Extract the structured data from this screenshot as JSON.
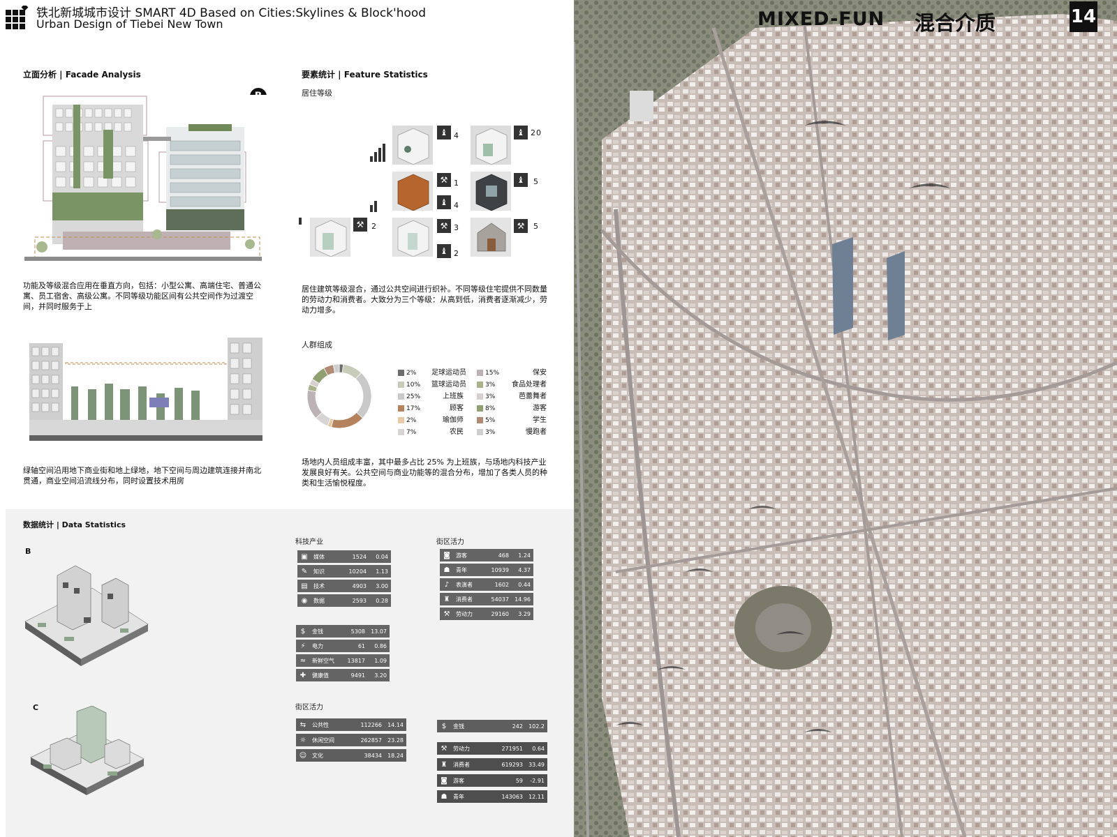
{
  "header": {
    "title_cn": "铁北新城城市设计  SMART 4D Based on Cities:Skylines & Block'hood",
    "title_en": "Urban Design of Tiebei New Town"
  },
  "right_panel": {
    "heading_en": "MIXED-FUN",
    "heading_cn": "混合介质",
    "page_number": "14"
  },
  "facade": {
    "heading": "立面分析 | Facade Analysis",
    "badge": "B",
    "text1": "功能及等级混合应用在垂直方向，包括：小型公寓、高端住宅、普通公寓、员工宿舍、高级公寓。不同等级功能区间有公共空间作为过渡空间，并同时服务于上",
    "text2": "绿轴空间沿用地下商业街和地上绿地，地下空间与周边建筑连接并南北贯通，商业空间沿流线分布，同时设置技术用房"
  },
  "features": {
    "heading": "要素统计 | Feature Statistics",
    "residence_title": "居住等级",
    "residence_nums": [
      "4",
      "20",
      "1",
      "4",
      "5",
      "2",
      "3",
      "2",
      "5"
    ],
    "residence_text": "居住建筑等级混合，通过公共空间进行织补。不同等级住宅提供不同数量的劳动力和消费者。大致分为三个等级：从高到低，消费者逐渐减少，劳动力增多。",
    "crowd_title": "人群组成",
    "crowd_text": "场地内人员组成丰富，其中最多占比 25% 为上班族，与场地内科技产业发展良好有关。公共空间与商业功能等的混合分布，增加了各类人员的种类和生活愉悦程度。"
  },
  "chart_data": {
    "type": "pie",
    "title": "人群组成",
    "series": [
      {
        "name": "足球运动员",
        "value": 2,
        "color": "#6d6d6d"
      },
      {
        "name": "篮球运动员",
        "value": 10,
        "color": "#c7ccb8"
      },
      {
        "name": "上班族",
        "value": 25,
        "color": "#c9c9c9"
      },
      {
        "name": "顾客",
        "value": 17,
        "color": "#b4825c"
      },
      {
        "name": "瑜伽师",
        "value": 2,
        "color": "#e8c9a6"
      },
      {
        "name": "农民",
        "value": 7,
        "color": "#d9d4d4"
      },
      {
        "name": "保安",
        "value": 15,
        "color": "#bdb3b6"
      },
      {
        "name": "食品处理者",
        "value": 3,
        "color": "#a8b38c"
      },
      {
        "name": "芭蕾舞者",
        "value": 3,
        "color": "#d8cfcf"
      },
      {
        "name": "游客",
        "value": 8,
        "color": "#90a070"
      },
      {
        "name": "学生",
        "value": 5,
        "color": "#b08a72"
      },
      {
        "name": "慢跑者",
        "value": 3,
        "color": "#cfcfcf"
      }
    ],
    "labels_pct": [
      "2%",
      "10%",
      "25%",
      "17%",
      "2%",
      "7%",
      "15%",
      "3%",
      "3%",
      "8%",
      "5%",
      "3%"
    ]
  },
  "data_stats": {
    "heading": "数据统计 | Data Statistics",
    "label_b": "B",
    "label_c": "C",
    "tech_title": "科技产业",
    "tech": [
      {
        "icon": "▣",
        "label": "媒体",
        "v1": "1524",
        "v2": "0.04"
      },
      {
        "icon": "✎",
        "label": "知识",
        "v1": "10204",
        "v2": "1.13"
      },
      {
        "icon": "▤",
        "label": "技术",
        "v1": "4903",
        "v2": "3.00"
      },
      {
        "icon": "◉",
        "label": "数据",
        "v1": "2593",
        "v2": "0.28"
      }
    ],
    "money": [
      {
        "icon": "$",
        "label": "金钱",
        "v1": "5308",
        "v2": "13.07"
      },
      {
        "icon": "⚡",
        "label": "电力",
        "v1": "61",
        "v2": "0.86"
      },
      {
        "icon": "≈",
        "label": "新鲜空气",
        "v1": "13817",
        "v2": "1.09"
      },
      {
        "icon": "✚",
        "label": "健康值",
        "v1": "9491",
        "v2": "3.20"
      }
    ],
    "vitality_title_1": "街区活力",
    "vitality_1": [
      {
        "icon": "◙",
        "label": "游客",
        "v1": "468",
        "v2": "1.24"
      },
      {
        "icon": "☗",
        "label": "青年",
        "v1": "10939",
        "v2": "4.37"
      },
      {
        "icon": "♪",
        "label": "表演者",
        "v1": "1602",
        "v2": "0.44"
      },
      {
        "icon": "♜",
        "label": "消费者",
        "v1": "54037",
        "v2": "14.96"
      },
      {
        "icon": "⚒",
        "label": "劳动力",
        "v1": "29160",
        "v2": "3.29"
      }
    ],
    "vitality_title_2": "街区活力",
    "vitality_2": [
      {
        "icon": "⇆",
        "label": "公共性",
        "v1": "112266",
        "v2": "14.14"
      },
      {
        "icon": "☼",
        "label": "休闲空间",
        "v1": "262857",
        "v2": "23.28"
      },
      {
        "icon": "☺",
        "label": "文化",
        "v1": "38434",
        "v2": "18.24"
      }
    ],
    "c_money": [
      {
        "icon": "$",
        "label": "金钱",
        "v1": "242",
        "v2": "102.2"
      }
    ],
    "c_people": [
      {
        "icon": "⚒",
        "label": "劳动力",
        "v1": "271951",
        "v2": "0.64"
      },
      {
        "icon": "♜",
        "label": "消费者",
        "v1": "619293",
        "v2": "33.49"
      },
      {
        "icon": "◙",
        "label": "游客",
        "v1": "59",
        "v2": "-2.91"
      },
      {
        "icon": "☗",
        "label": "青年",
        "v1": "143063",
        "v2": "12.11"
      }
    ]
  }
}
